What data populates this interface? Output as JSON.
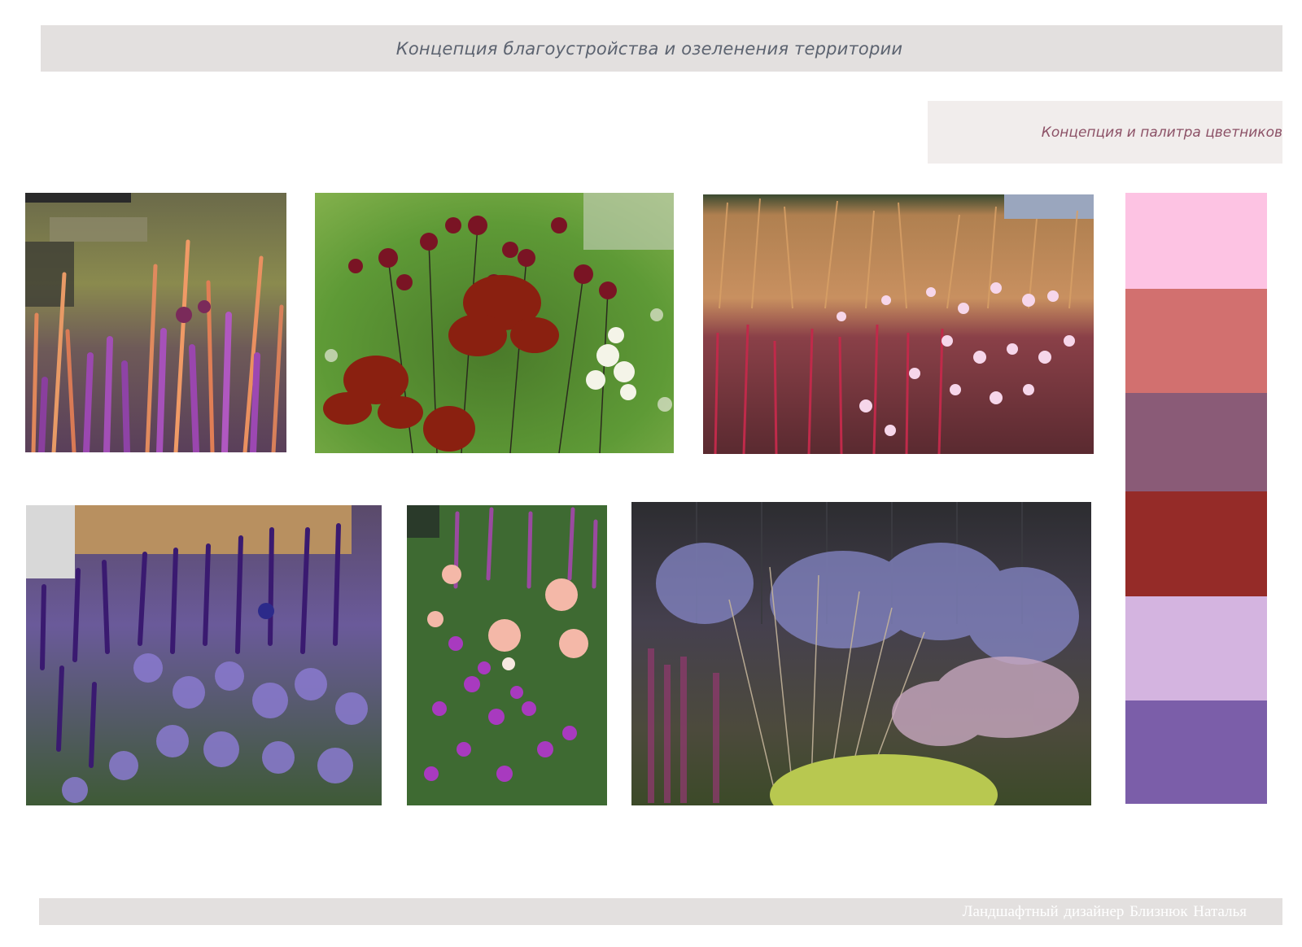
{
  "header": {
    "title": "Концепция благоустройства и озеленения территории"
  },
  "section": {
    "subtitle": "Концепция и палитра цветников"
  },
  "palette": {
    "swatches": [
      {
        "color": "#fdc3e3"
      },
      {
        "color": "#d2706f"
      },
      {
        "color": "#8a5b77"
      },
      {
        "color": "#952b28"
      },
      {
        "color": "#d4b4e0"
      },
      {
        "color": "#7b5ea9"
      }
    ]
  },
  "footer": {
    "text": "Ландшафтный дизайнер   Близнюк Наталья"
  }
}
